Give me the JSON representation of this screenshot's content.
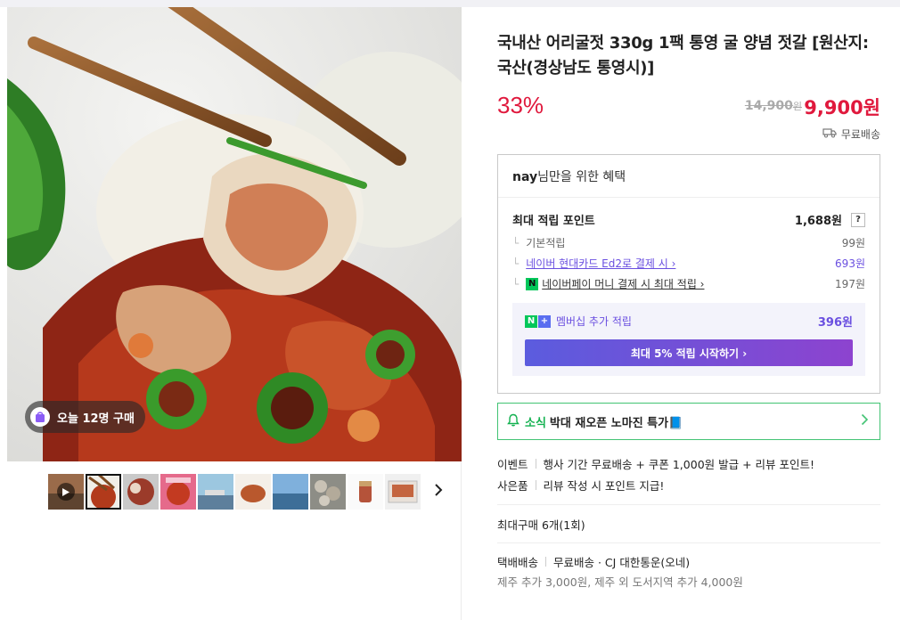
{
  "product": {
    "title": "국내산 어리굴젓 330g 1팩 통영 굴 양념 젓갈 [원산지: 국산(경상남도 통영시)]",
    "discount": "33%",
    "original_price": "14,900",
    "original_unit": "원",
    "sale_price": "9,900원",
    "shipping_label": "무료배송"
  },
  "gallery": {
    "buy_badge": "오늘 12명 구매",
    "thumbnail_count": 10
  },
  "benefit": {
    "title_user": "nay",
    "title_rest": "님만을 위한 혜택",
    "max_points_label": "최대 적립 포인트",
    "max_points_value": "1,688원",
    "help": "?",
    "rows": [
      {
        "label": "기본적립",
        "value": "99원"
      },
      {
        "label": "네이버 현대카드 Ed2로 결제 시 ›",
        "value": "693원"
      },
      {
        "label": "네이버페이 머니 결제 시 최대 적립 ›",
        "value": "197원"
      }
    ],
    "membership_label": "멤버십 추가 적립",
    "membership_value": "396원",
    "membership_button": "최대 5% 적립 시작하기 ›"
  },
  "news": {
    "tag": "소식",
    "text": "박대 재오픈 노마진 특가📘"
  },
  "info": {
    "event_key": "이벤트",
    "event_value": "행사 기간 무료배송 + 쿠폰 1,000원 발급 + 리뷰 포인트!",
    "gift_key": "사은품",
    "gift_value": "리뷰 작성 시 포인트 지급!",
    "max_buy": "최대구매 6개(1회)",
    "delivery_key": "택배배송",
    "delivery_value": "무료배송 · CJ 대한통운(오네)",
    "delivery_extra": "제주 추가 3,000원, 제주 외 도서지역 추가 4,000원"
  },
  "colors": {
    "accent_red": "#e0193d",
    "purple": "#6a4fe0",
    "green": "#03c75a"
  }
}
